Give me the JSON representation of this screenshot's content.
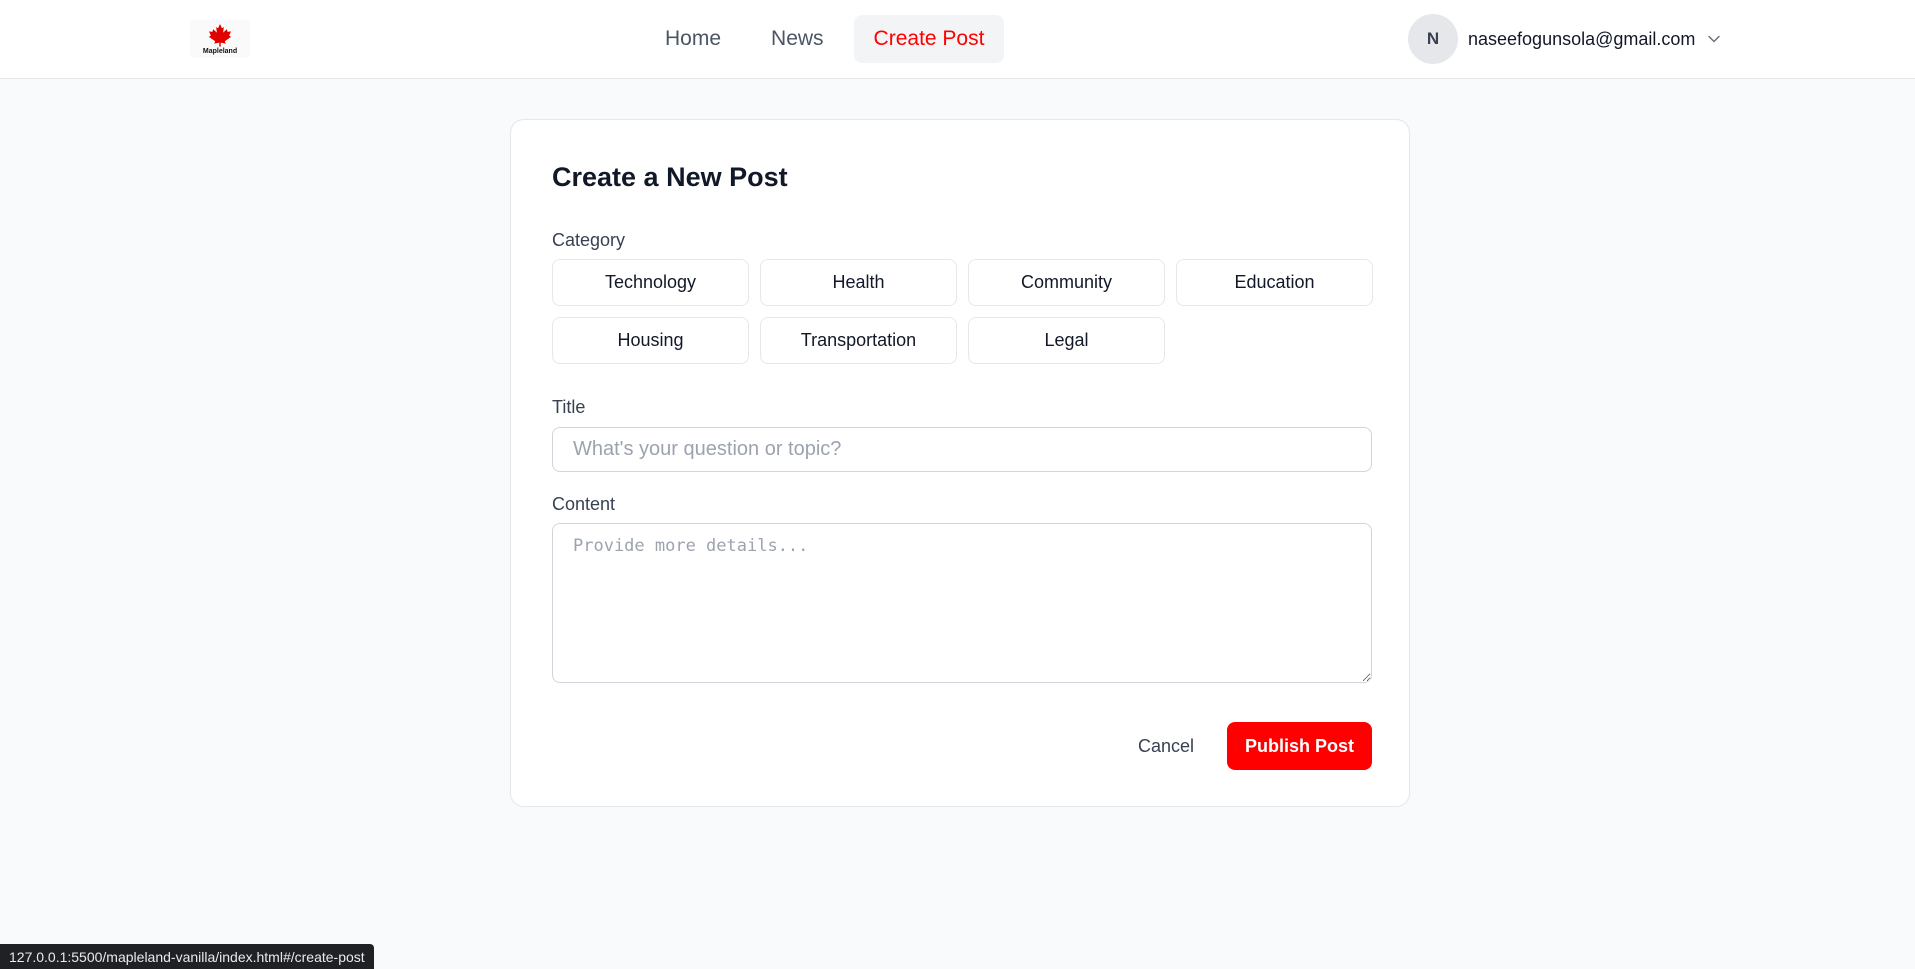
{
  "header": {
    "logo_text": "Mapleland",
    "nav": [
      {
        "label": "Home"
      },
      {
        "label": "News"
      },
      {
        "label": "Create Post"
      }
    ],
    "user": {
      "avatar_initial": "N",
      "email": "naseefogunsola@gmail.com"
    }
  },
  "form": {
    "title": "Create a New Post",
    "category_label": "Category",
    "categories": [
      "Technology",
      "Health",
      "Community",
      "Education",
      "Housing",
      "Transportation",
      "Legal"
    ],
    "title_label": "Title",
    "title_placeholder": "What's your question or topic?",
    "content_label": "Content",
    "content_placeholder": "Provide more details...",
    "cancel_label": "Cancel",
    "publish_label": "Publish Post"
  },
  "status_url": "127.0.0.1:5500/mapleland-vanilla/index.html#/create-post",
  "colors": {
    "accent": "#ff0000",
    "active_nav_bg": "#f3f4f6",
    "page_bg": "#f9fafb"
  },
  "icons": {
    "logo": "maple-leaf-icon",
    "user_menu": "chevron-down-icon"
  }
}
